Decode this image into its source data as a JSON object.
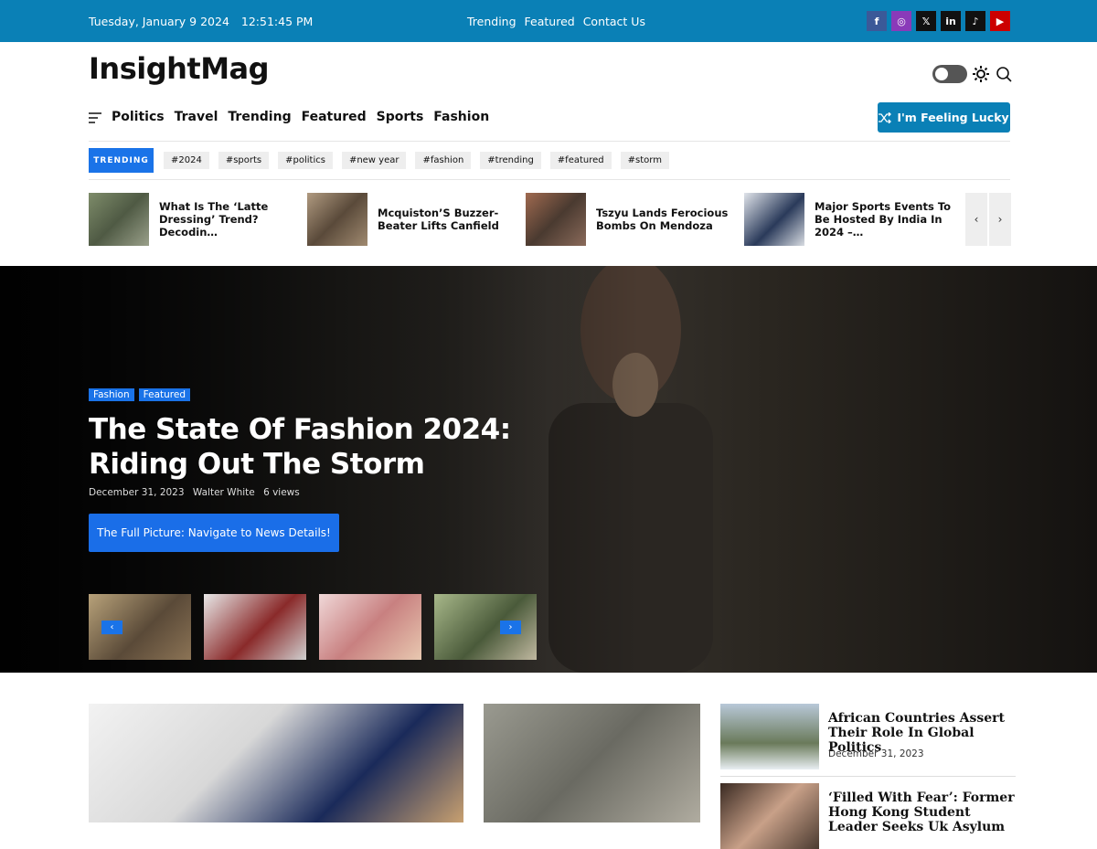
{
  "topbar": {
    "date": "Tuesday, January 9 2024",
    "time": "12:51:45 PM",
    "links": [
      "Trending",
      "Featured",
      "Contact Us"
    ],
    "social": [
      {
        "icon": "facebook-icon",
        "glyph": "f",
        "color": "#3b5998"
      },
      {
        "icon": "instagram-icon",
        "glyph": "◎",
        "color": "#8a3ab9"
      },
      {
        "icon": "x-icon",
        "glyph": "𝕏",
        "color": "#111111"
      },
      {
        "icon": "linkedin-icon",
        "glyph": "in",
        "color": "#111111"
      },
      {
        "icon": "tiktok-icon",
        "glyph": "♪",
        "color": "#111111"
      },
      {
        "icon": "youtube-icon",
        "glyph": "▶",
        "color": "#cc0000"
      }
    ]
  },
  "brand": {
    "logo": "InsightMag"
  },
  "nav": {
    "items": [
      "Politics",
      "Travel",
      "Trending",
      "Featured",
      "Sports",
      "Fashion"
    ],
    "lucky_label": "I'm Feeling Lucky"
  },
  "trending": {
    "label": "TRENDING",
    "tags": [
      "#2024",
      "#sports",
      "#politics",
      "#new year",
      "#fashion",
      "#trending",
      "#featured",
      "#storm"
    ]
  },
  "ticker": {
    "items": [
      {
        "title": "What Is The ‘Latte Dressing’ Trend? Decodin…",
        "thumb": "#6f7d62"
      },
      {
        "title": "Mcquiston’S Buzzer-Beater Lifts Canfield",
        "thumb": "#8a7a6a"
      },
      {
        "title": "Tszyu Lands Ferocious Bombs On Mendoza",
        "thumb": "#7a5a4a"
      },
      {
        "title": "Major Sports Events To Be Hosted By India In 2024 –…",
        "thumb": "#c8ccd2"
      }
    ],
    "prev_icon": "chevron-left-icon",
    "next_icon": "chevron-right-icon"
  },
  "hero": {
    "categories": [
      "Fashion",
      "Featured"
    ],
    "title": "The State Of Fashion 2024: Riding Out The Storm",
    "date": "December 31, 2023",
    "author": "Walter White",
    "views": "6 views",
    "cta": "The Full Picture: Navigate to News Details!",
    "thumbs": [
      "#8b7355",
      "#d8d8d8",
      "#e2c0c0",
      "#8a9a6a"
    ]
  },
  "bottom": {
    "side_items": [
      {
        "title": "African Countries Assert Their Role In Global Politics",
        "date": "December 31, 2023",
        "thumb": "#9fb0c4"
      },
      {
        "title": "‘Filled With Fear’: Former Hong Kong Student Leader Seeks Uk Asylum",
        "date": "",
        "thumb": "#4a3a30"
      }
    ]
  },
  "colors": {
    "primary": "#0a80b6",
    "accent": "#1a73e8"
  }
}
